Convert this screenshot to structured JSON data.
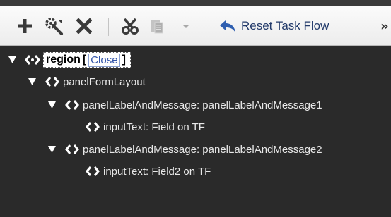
{
  "toolbar": {
    "items": [
      {
        "name": "add",
        "icon": "plus-icon"
      },
      {
        "name": "edit",
        "icon": "wrench-gear-icon"
      },
      {
        "name": "delete",
        "icon": "x-icon"
      },
      {
        "name": "cut",
        "icon": "scissors-icon"
      },
      {
        "name": "paste",
        "icon": "clipboard-icon"
      },
      {
        "name": "paste-menu",
        "icon": "chevron-down-icon"
      },
      {
        "name": "reset",
        "icon": "undo-arrow-icon"
      }
    ],
    "reset_label": "Reset Task Flow",
    "overflow_label": "»"
  },
  "tree": {
    "root": {
      "label": "region",
      "open_bracket": "[",
      "close_link": "Close",
      "close_bracket": "]"
    },
    "nodes": [
      {
        "label": "panelFormLayout"
      },
      {
        "label": "panelLabelAndMessage: panelLabelAndMessage1"
      },
      {
        "label": "inputText: Field on TF"
      },
      {
        "label": "panelLabelAndMessage: panelLabelAndMessage2"
      },
      {
        "label": "inputText: Field2 on TF"
      }
    ]
  },
  "colors": {
    "toolbar_bg": "#f2f2f2",
    "tree_bg": "#2a2a2a",
    "tree_text": "#e8e8e8",
    "selection_bg": "#ffffff",
    "link": "#3355aa",
    "reset_arrow": "#2f5fb0"
  }
}
